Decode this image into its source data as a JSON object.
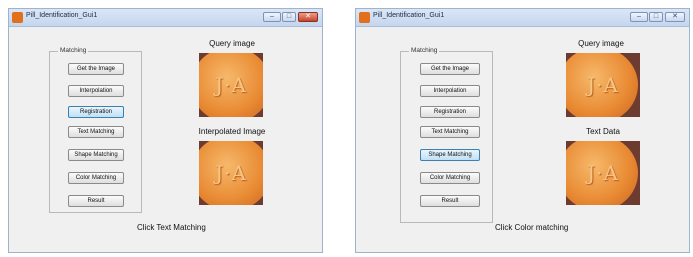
{
  "windows": [
    {
      "title": "Pill_Identification_Gui1",
      "group_label": "Matching",
      "buttons": [
        "Get the Image",
        "Interpolation",
        "Registration",
        "Text Matching",
        "Shape Matching",
        "Color Matching",
        "Result"
      ],
      "focused_button": "Registration",
      "top_caption": "Query image",
      "bottom_caption": "Interpolated Image",
      "pill_imprint": "J·A",
      "status": "Click Text Matching"
    },
    {
      "title": "Pill_Identification_Gui1",
      "group_label": "Matching",
      "buttons": [
        "Get the Image",
        "Interpolation",
        "Registration",
        "Text Matching",
        "Shape Matching",
        "Color Matching",
        "Result"
      ],
      "focused_button": "Shape Matching",
      "top_caption": "Query image",
      "bottom_caption": "Text Data",
      "pill_imprint": "J·A",
      "status": "Click Color matching"
    }
  ],
  "window_controls": {
    "minimize": "–",
    "maximize": "□",
    "close": "✕"
  },
  "colors": {
    "title_bar": "#c4d6ee",
    "pill_orange": "#e98b34",
    "close_button": "#c8442b",
    "focus_button": "#bfe0f5"
  }
}
